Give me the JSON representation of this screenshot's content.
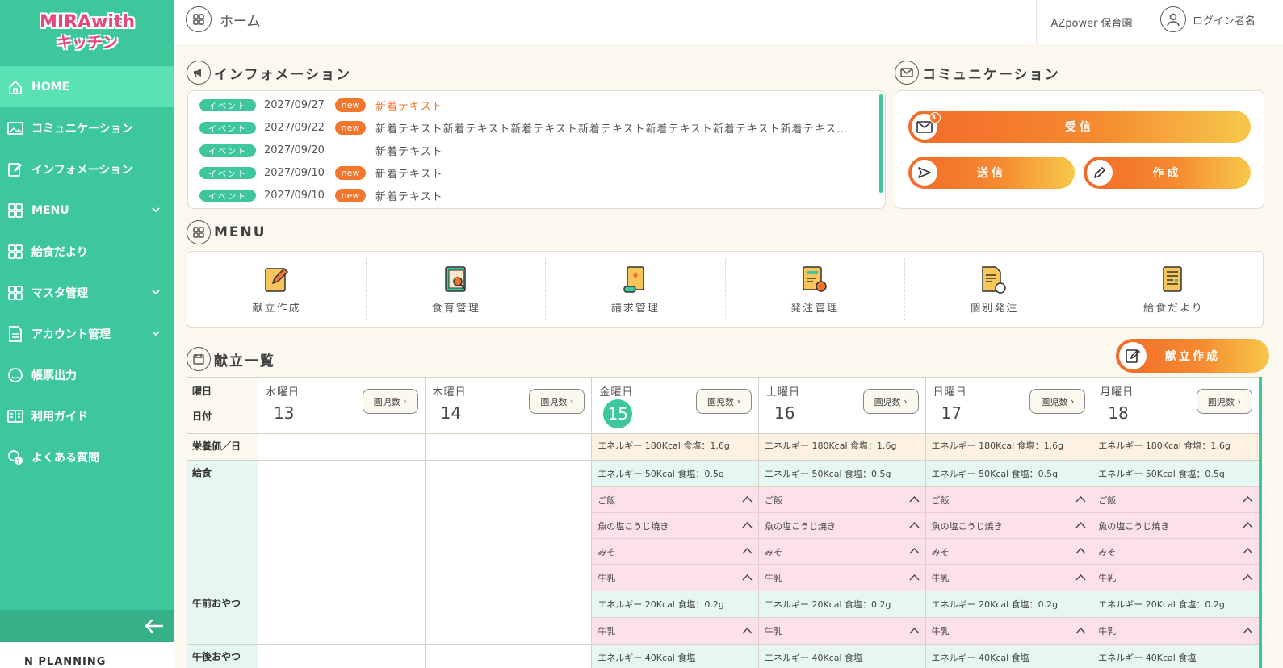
{
  "brand": {
    "line1": "MIRAwith",
    "line2": "キッチン",
    "footer": "N PLANNING"
  },
  "sidebar": {
    "items": [
      {
        "label": "HOME",
        "icon": "home-icon",
        "active": true,
        "expandable": false
      },
      {
        "label": "コミュニケーション",
        "icon": "image-icon",
        "active": false,
        "expandable": false
      },
      {
        "label": "インフォメーション",
        "icon": "edit-icon",
        "active": false,
        "expandable": false
      },
      {
        "label": "MENU",
        "icon": "grid-icon",
        "active": false,
        "expandable": true
      },
      {
        "label": "給食だより",
        "icon": "grid-icon",
        "active": false,
        "expandable": false
      },
      {
        "label": "マスタ管理",
        "icon": "grid-icon",
        "active": false,
        "expandable": true
      },
      {
        "label": "アカウント管理",
        "icon": "document-icon",
        "active": false,
        "expandable": true
      },
      {
        "label": "帳票出力",
        "icon": "face-icon",
        "active": false,
        "expandable": false
      },
      {
        "label": "利用ガイド",
        "icon": "book-icon",
        "active": false,
        "expandable": false
      },
      {
        "label": "よくある質問",
        "icon": "question-icon",
        "active": false,
        "expandable": false
      }
    ]
  },
  "header": {
    "title": "ホーム",
    "organization": "AZpower 保育園",
    "user": "ログイン者名"
  },
  "information": {
    "title": "インフォメーション",
    "items": [
      {
        "tag": "イベント",
        "date": "2027/09/27",
        "new": true,
        "text": "新着テキスト",
        "highlight": true
      },
      {
        "tag": "イベント",
        "date": "2027/09/22",
        "new": true,
        "text": "新着テキスト新着テキスト新着テキスト新着テキスト新着テキスト新着テキスト新着テキス…",
        "highlight": false
      },
      {
        "tag": "イベント",
        "date": "2027/09/20",
        "new": false,
        "text": "新着テキスト",
        "highlight": false
      },
      {
        "tag": "イベント",
        "date": "2027/09/10",
        "new": true,
        "text": "新着テキスト",
        "highlight": false
      },
      {
        "tag": "イベント",
        "date": "2027/09/10",
        "new": true,
        "text": "新着テキスト",
        "highlight": false
      }
    ],
    "new_label": "new"
  },
  "communication": {
    "title": "コミュニケーション",
    "receive": "受信",
    "receive_count": "3",
    "send": "送信",
    "compose": "作成"
  },
  "menu": {
    "title": "MENU",
    "items": [
      {
        "label": "献立作成",
        "icon": "pencil-note-icon"
      },
      {
        "label": "食育管理",
        "icon": "book-search-icon"
      },
      {
        "label": "請求管理",
        "icon": "scroll-icon"
      },
      {
        "label": "発注管理",
        "icon": "order-gear-icon"
      },
      {
        "label": "個別発注",
        "icon": "document-refresh-icon"
      },
      {
        "label": "給食だより",
        "icon": "newsletter-icon"
      }
    ]
  },
  "kondate": {
    "title": "献立一覧",
    "create_button": "献立作成",
    "row_labels": {
      "weekday": "曜日",
      "date": "日付",
      "nutrition": "栄養価／日",
      "lunch": "給食",
      "am_snack": "午前おやつ",
      "pm_snack": "午後おやつ"
    },
    "children_button": "園児数",
    "days": [
      {
        "weekday": "水曜日",
        "date": "13",
        "today": false,
        "has_menu": false
      },
      {
        "weekday": "木曜日",
        "date": "14",
        "today": false,
        "has_menu": false
      },
      {
        "weekday": "金曜日",
        "date": "15",
        "today": true,
        "has_menu": true
      },
      {
        "weekday": "土曜日",
        "date": "16",
        "today": false,
        "has_menu": true
      },
      {
        "weekday": "日曜日",
        "date": "17",
        "today": false,
        "has_menu": true
      },
      {
        "weekday": "月曜日",
        "date": "18",
        "today": false,
        "has_menu": true
      }
    ],
    "nutrition_text": "エネルギー 180Kcal 食塩：1.6g",
    "lunch": {
      "energy": "エネルギー 50Kcal 食塩：0.5g",
      "foods": [
        "ご飯",
        "魚の塩こうじ焼き",
        "みそ",
        "牛乳"
      ]
    },
    "am_snack": {
      "energy": "エネルギー 20Kcal 食塩：0.2g",
      "foods": [
        "牛乳"
      ]
    },
    "pm_snack": {
      "energy": "エネルギー 40Kcal 食塩"
    }
  },
  "colors": {
    "primary_green": "#3ec79d",
    "active_green": "#59e0b4",
    "accent_orange": "#f2762b",
    "food_pink": "#fce0ea",
    "energy_mint": "#e6f7f3",
    "nutrition_peach": "#fdf1e2"
  }
}
